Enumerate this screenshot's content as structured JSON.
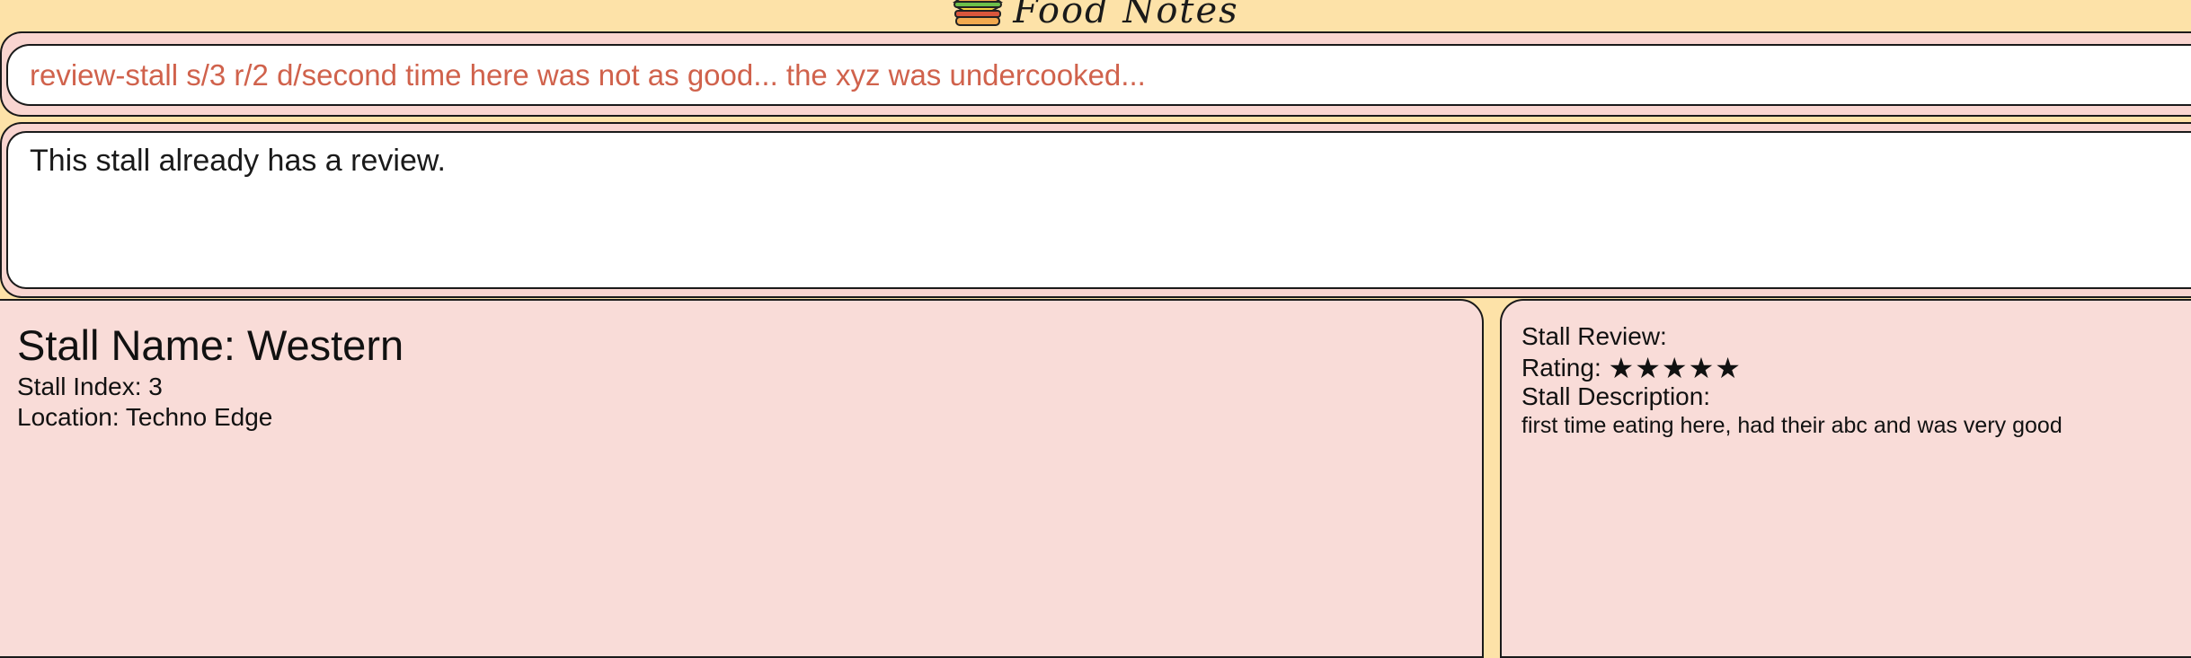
{
  "app": {
    "title": "Food Notes",
    "logo_icon": "sandwich-icon"
  },
  "command": {
    "value": "review-stall s/3 r/2 d/second time here was not as good... the xyz was undercooked...",
    "text_color": "#d0624c"
  },
  "result": {
    "message": "This stall already has a review."
  },
  "stall": {
    "name_label": "Stall Name: Western",
    "index_label": "Stall Index: 3",
    "location_label": "Location: Techno Edge"
  },
  "review": {
    "heading": "Stall Review:",
    "rating_label": "Rating:",
    "rating_stars": "★★★★★",
    "rating_value": 5,
    "rating_max": 5,
    "description_label": "Stall Description:",
    "description": "first time eating here, had their abc and was very good"
  },
  "colors": {
    "background": "#fde2a8",
    "panel": "#f9dcd8",
    "border": "#1a1a1a"
  }
}
